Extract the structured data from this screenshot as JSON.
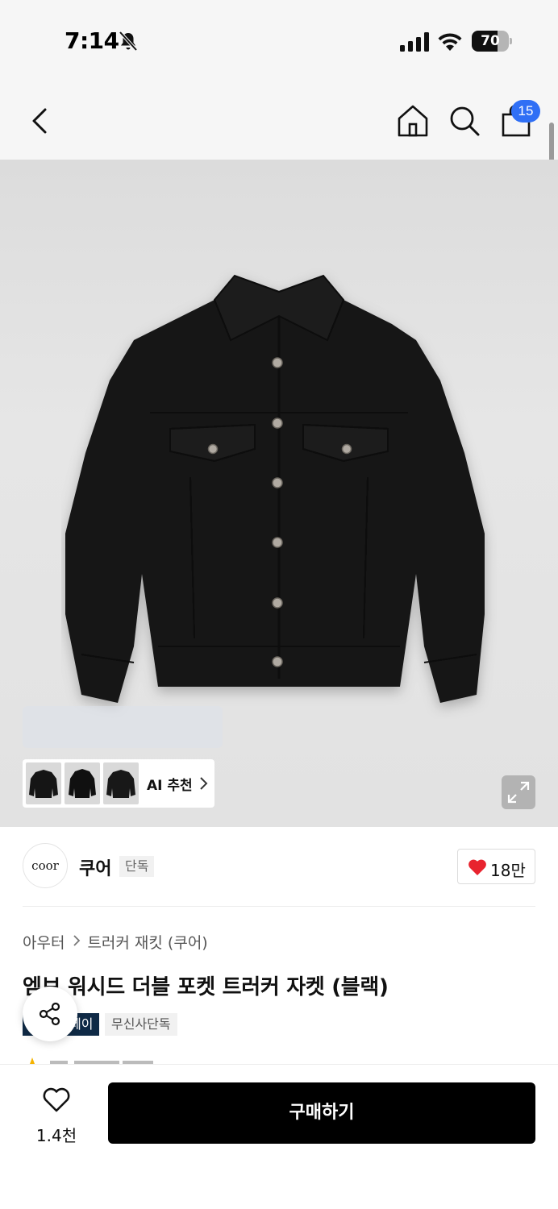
{
  "status_bar": {
    "time": "7:14",
    "battery_level": "70",
    "battery_fraction": 0.7
  },
  "nav": {
    "cart_count": "15",
    "icons": [
      "back-arrow",
      "home",
      "search",
      "shopping-bag"
    ]
  },
  "product_image": {
    "ai_recommend_label": "AI 추천",
    "thumbnail_count": 3
  },
  "brand": {
    "logo_text": "coor",
    "name": "쿠어",
    "tag": "단독",
    "like_count": "18만"
  },
  "category": {
    "level1": "아우터",
    "level2": "트러커 재킷 (쿠어)"
  },
  "product": {
    "title": "엠브 워시드 더블 포켓 트러커 자켓 (블랙)",
    "tags": [
      "페이",
      "무신사단독"
    ]
  },
  "bottom_bar": {
    "wish_count": "1.4천",
    "buy_label": "구매하기"
  },
  "colors": {
    "accent": "#2f6ff5",
    "heart": "#e8232e",
    "pay_tag": "#0f2a46",
    "buy_button": "#000000"
  }
}
